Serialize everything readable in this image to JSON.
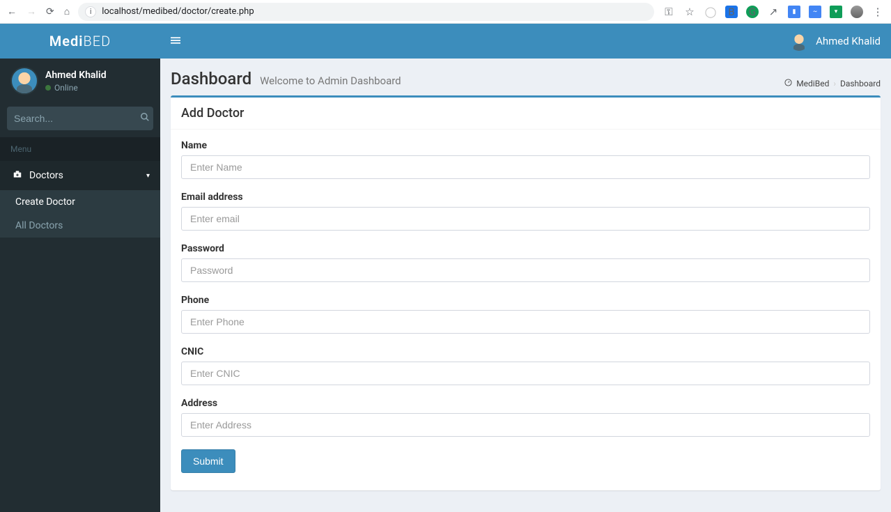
{
  "browser": {
    "url": "localhost/medibed/doctor/create.php"
  },
  "logo": {
    "bold": "Medi",
    "light": "BED"
  },
  "user": {
    "name": "Ahmed Khalid",
    "status": "Online"
  },
  "search": {
    "placeholder": "Search..."
  },
  "menu": {
    "label": "Menu",
    "doctors": "Doctors",
    "create": "Create Doctor",
    "all": "All Doctors"
  },
  "topbar": {
    "user": "Ahmed Khalid"
  },
  "page": {
    "title": "Dashboard",
    "subtitle": "Welcome to Admin Dashboard",
    "crumb1": "MediBed",
    "crumb2": "Dashboard"
  },
  "form": {
    "title": "Add Doctor",
    "name_label": "Name",
    "name_ph": "Enter Name",
    "email_label": "Email address",
    "email_ph": "Enter email",
    "password_label": "Password",
    "password_ph": "Password",
    "phone_label": "Phone",
    "phone_ph": "Enter Phone",
    "cnic_label": "CNIC",
    "cnic_ph": "Enter CNIC",
    "address_label": "Address",
    "address_ph": "Enter Address",
    "submit": "Submit"
  }
}
